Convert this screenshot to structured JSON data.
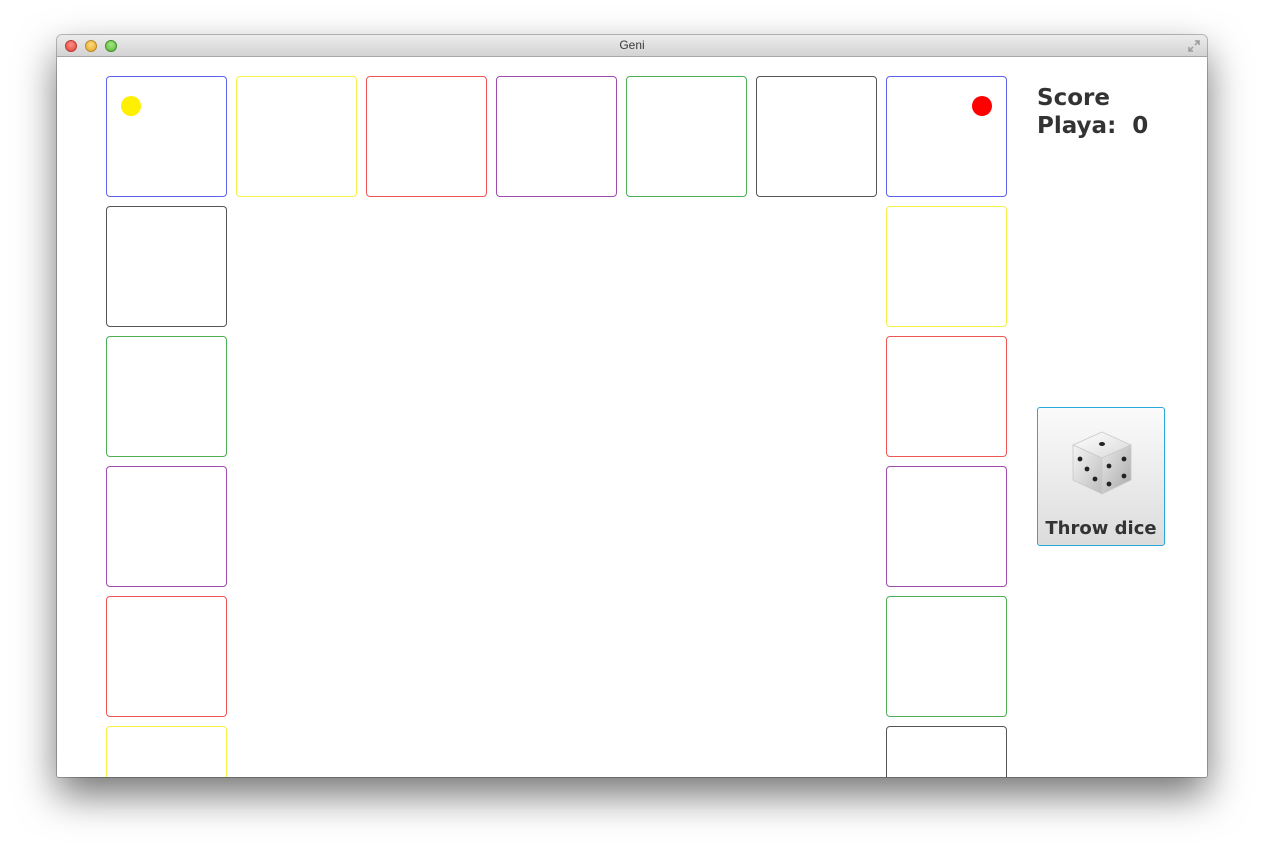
{
  "window": {
    "title": "Geni"
  },
  "score": {
    "heading": "Score",
    "player_label": "Playa:",
    "player_value": "0"
  },
  "dice_button": {
    "label": "Throw dice"
  },
  "colors": {
    "blue": "#5e62e8",
    "yellow": "#f5f04a",
    "red": "#ee5656",
    "purple": "#a04bb0",
    "green": "#4caf58",
    "gray": "#555555",
    "accent": "#2aa7d9",
    "token_yellow": "#ffef00",
    "token_red": "#ff0000"
  },
  "board": {
    "top_row": [
      "blue",
      "yellow",
      "red",
      "purple",
      "green",
      "gray",
      "blue"
    ],
    "left_column": [
      "gray",
      "green",
      "purple",
      "red",
      "yellow"
    ],
    "right_column": [
      "yellow",
      "red",
      "purple",
      "green",
      "gray"
    ]
  },
  "tokens": [
    {
      "color": "token_yellow",
      "on": "top_row",
      "index": 0,
      "corner": "top-left"
    },
    {
      "color": "token_red",
      "on": "top_row",
      "index": 6,
      "corner": "top-right"
    }
  ]
}
